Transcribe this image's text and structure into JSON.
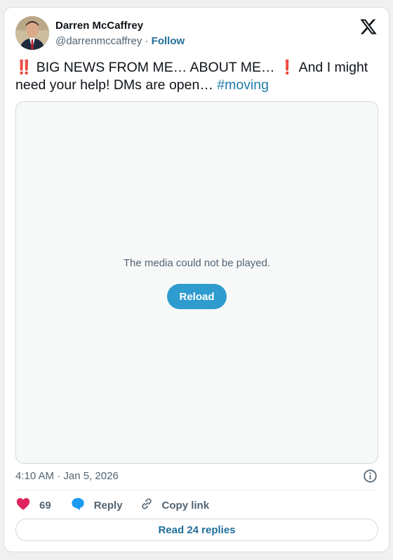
{
  "author": {
    "name": "Darren McCaffrey",
    "handle": "@darrenmccaffrey",
    "separator": " · ",
    "follow_label": "Follow"
  },
  "logo_icon": "x-logo-icon",
  "tweet": {
    "excl_double": "‼️",
    "part1": " BIG NEWS FROM ME… ABOUT ME… ",
    "excl_single": "❗",
    "part2": " And I might need your help! DMs are open… ",
    "hashtag": "#moving"
  },
  "media": {
    "message": "The media could not be played.",
    "reload_label": "Reload"
  },
  "timestamp": "4:10 AM · Jan 5, 2026",
  "actions": {
    "like_count": "69",
    "reply_label": "Reply",
    "copy_label": "Copy link"
  },
  "read_replies_label": "Read 24 replies",
  "colors": {
    "accent": "#1f6f9a",
    "reload_bg": "#2f9ccf",
    "heart": "#e0245e",
    "reply_bubble": "#1d9bf0"
  }
}
